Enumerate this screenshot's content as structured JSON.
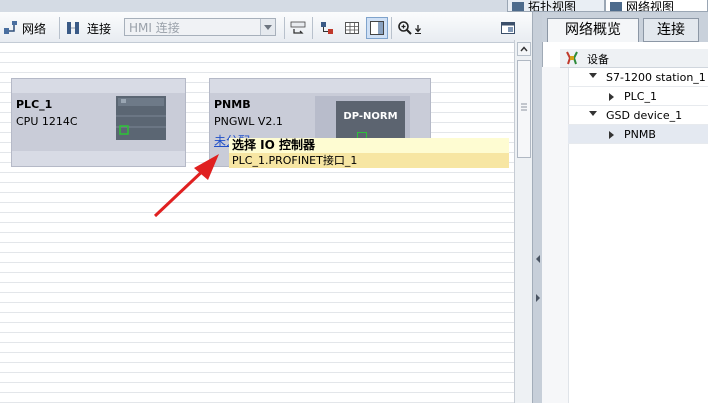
{
  "view_tabs": {
    "topology": "拓扑视图",
    "network": "网络视图"
  },
  "toolbar": {
    "network_label": "网络",
    "connection_label": "连接",
    "connection_select_value": "HMI 连接"
  },
  "devices": [
    {
      "name": "PLC_1",
      "type": "CPU 1214C"
    },
    {
      "name": "PNMB",
      "type": "PNGWL V2.1",
      "module_label": "DP-NORM",
      "link_text": "未分配"
    }
  ],
  "tooltip": {
    "title": "选择 IO 控制器",
    "item": "PLC_1.PROFINET接口_1"
  },
  "right_panel": {
    "tabs": [
      "网络概览",
      "连接"
    ],
    "header": "设备",
    "tree": [
      {
        "label": "S7-1200 station_1",
        "expanded": true,
        "level": 0
      },
      {
        "label": "PLC_1",
        "expanded": false,
        "level": 1
      },
      {
        "label": "GSD device_1",
        "expanded": true,
        "level": 0
      },
      {
        "label": "PNMB",
        "expanded": false,
        "level": 1,
        "selected": true
      }
    ]
  },
  "colors": {
    "tooltip_title_bg": "#fefcd2",
    "tooltip_item_bg": "#f7e6a3",
    "device_bg": "#c9ccd8",
    "arrow": "#e02020",
    "port_green": "#2fbf3a"
  }
}
